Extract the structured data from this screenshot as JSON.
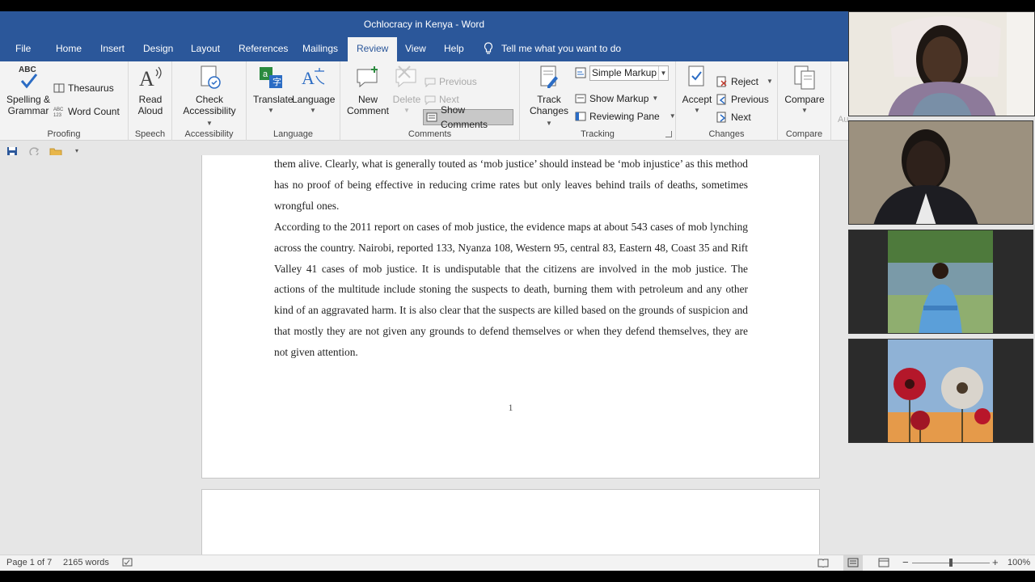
{
  "window": {
    "title": "Ochlocracy in Kenya  -  Word"
  },
  "tabs": [
    {
      "label": "File"
    },
    {
      "label": "Home"
    },
    {
      "label": "Insert"
    },
    {
      "label": "Design"
    },
    {
      "label": "Layout"
    },
    {
      "label": "References"
    },
    {
      "label": "Mailings"
    },
    {
      "label": "Review"
    },
    {
      "label": "View"
    },
    {
      "label": "Help"
    }
  ],
  "tell_me": {
    "placeholder": "Tell me what you want to do"
  },
  "ribbon": {
    "proofing": {
      "label": "Proofing",
      "abc": "ABC",
      "spelling": "Spelling &",
      "grammar": "Grammar",
      "thesaurus": "Thesaurus",
      "word_count": "Word Count"
    },
    "speech": {
      "label": "Speech",
      "read": "Read",
      "aloud": "Aloud"
    },
    "accessibility": {
      "label": "Accessibility",
      "check": "Check",
      "acc": "Accessibility"
    },
    "language": {
      "label": "Language",
      "translate": "Translate",
      "language": "Language"
    },
    "comments": {
      "label": "Comments",
      "new": "New",
      "comment": "Comment",
      "delete": "Delete",
      "previous": "Previous",
      "next": "Next",
      "show_comments": "Show Comments"
    },
    "tracking": {
      "label": "Tracking",
      "track": "Track",
      "changes": "Changes",
      "markup_select": "Simple Markup",
      "show_markup": "Show Markup",
      "reviewing_pane": "Reviewing Pane"
    },
    "changes": {
      "label": "Changes",
      "accept": "Accept",
      "reject": "Reject",
      "previous": "Previous",
      "next": "Next"
    },
    "compare": {
      "label": "Compare",
      "compare": "Compare",
      "truncated": "Au"
    }
  },
  "document": {
    "para1": "them alive. Clearly, what is generally touted as ‘mob justice’ should instead be ‘mob injustice’ as this method has no proof of being effective in reducing crime rates but only leaves behind trails of deaths, sometimes wrongful ones.",
    "para2": "According to the 2011 report on cases of mob justice, the evidence maps at about 543 cases of mob lynching across the country. Nairobi, reported 133, Nyanza 108, Western 95, central 83, Eastern 48, Coast 35 and Rift Valley 41 cases of mob justice. It is undisputable that the citizens are involved in the mob justice. The actions of the multitude include stoning the suspects to death, burning them with petroleum and any other kind of an aggravated harm. It is also clear that the suspects are killed based on the grounds of suspicion and that mostly they are not given any grounds to defend themselves or when they defend themselves, they are not given attention.",
    "page_number": "1"
  },
  "status": {
    "page": "Page 1 of 7",
    "words": "2165 words",
    "zoom": "100%",
    "zoom_level": 0.5
  },
  "colors": {
    "accent": "#2b579a",
    "ribbon": "#f3f3f3"
  }
}
